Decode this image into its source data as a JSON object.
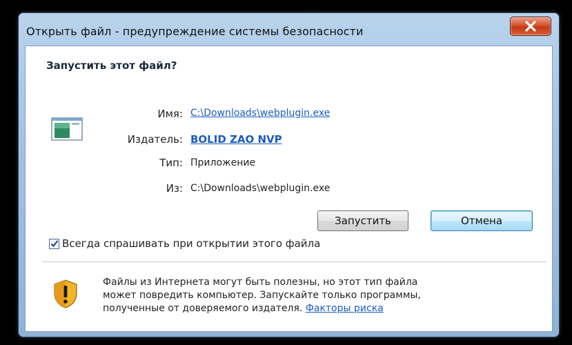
{
  "window": {
    "title": "Открыть файл - предупреждение системы безопасности",
    "close_label": "X"
  },
  "dialog": {
    "question": "Запустить этот файл?",
    "fields": {
      "name_label": "Имя:",
      "name_value": "C:\\Downloads\\webplugin.exe",
      "publisher_label": "Издатель:",
      "publisher_value": "BOLID ZAO NVP",
      "type_label": "Тип:",
      "type_value": "Приложение",
      "from_label": "Из:",
      "from_value": "C:\\Downloads\\webplugin.exe"
    },
    "buttons": {
      "run": "Запустить",
      "cancel": "Отмена"
    },
    "checkbox": {
      "label": "Всегда спрашивать при открытии этого файла",
      "checked": true
    },
    "warning": {
      "line1": "Файлы из Интернета могут быть полезны, но этот тип файла",
      "line2": "может повредить компьютер. Запускайте только программы,",
      "line3_text": "полученные от доверяемого издателя. ",
      "link": "Факторы риска"
    }
  },
  "icons": {
    "app": "application-icon",
    "shield": "security-shield-icon",
    "close": "close-icon",
    "check": "checkmark-icon"
  }
}
